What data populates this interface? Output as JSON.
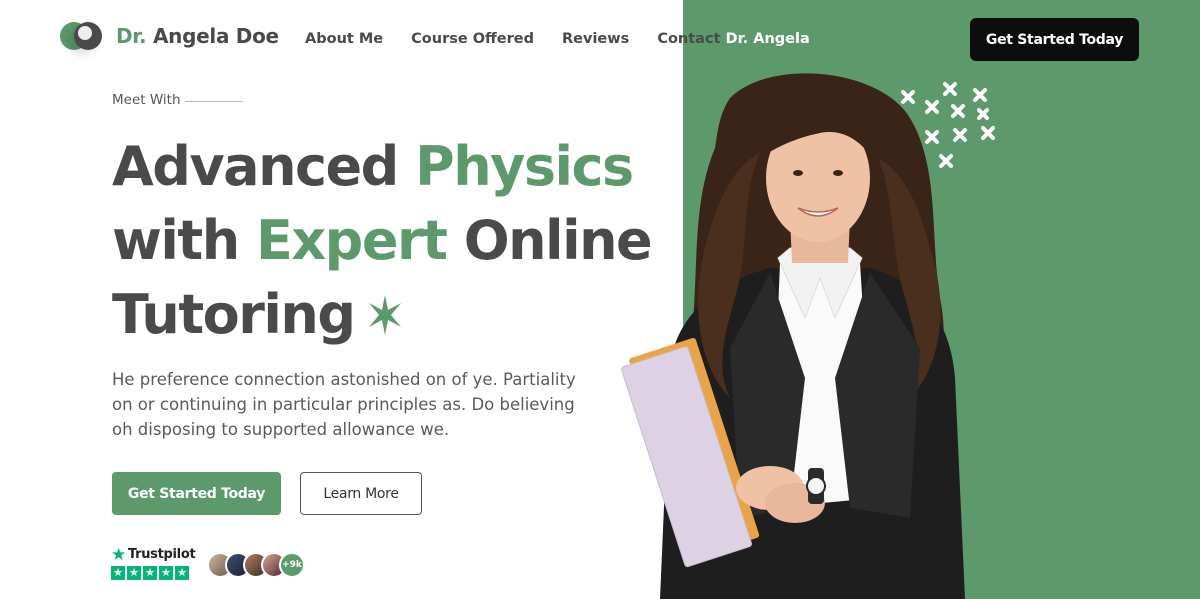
{
  "brand": {
    "prefix": "Dr.",
    "name": "Angela Doe",
    "accent_color": "#5c9a6c",
    "dark_color": "#4a4a4a"
  },
  "nav": {
    "items": [
      "About Me",
      "Course Offered",
      "Reviews"
    ],
    "contact_prefix": "Contact",
    "contact_suffix": "Dr. Angela"
  },
  "header": {
    "cta_label": "Get Started Today"
  },
  "hero": {
    "eyebrow": "Meet With",
    "headline": {
      "line1_a": "Advanced ",
      "line1_b": "Physics",
      "line2_a": "with ",
      "line2_b": "Expert",
      "line2_c": " Online",
      "line3": "Tutoring"
    },
    "description": "He preference connection astonished on of ye. Partiality on or continuing in particular principles as. Do believing oh disposing to supported allowance we.",
    "primary_button": "Get Started Today",
    "secondary_button": "Learn More"
  },
  "social_proof": {
    "trustpilot_label": "Trustpilot",
    "rating_stars": 5,
    "avatar_count_label": "+9k"
  },
  "icons": {
    "sparkle": "sparkle-star-icon",
    "trustpilot": "trustpilot-star-icon",
    "decor": "cross-pattern-icon"
  }
}
